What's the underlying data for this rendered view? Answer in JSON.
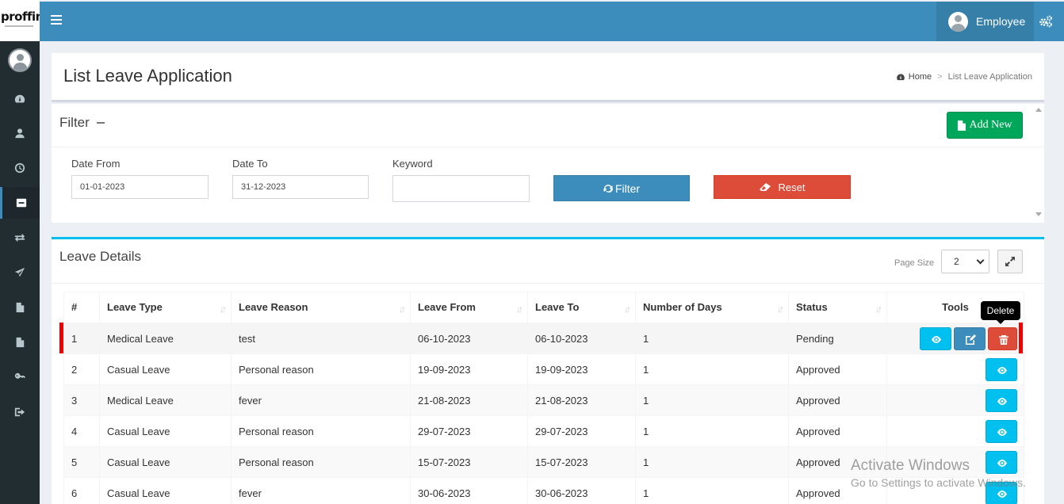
{
  "app": {
    "logo": "proffin"
  },
  "header": {
    "user_name": "Employee"
  },
  "page": {
    "title": "List Leave Application"
  },
  "breadcrumb": {
    "home": "Home",
    "current": "List Leave Application"
  },
  "filter": {
    "title": "Filter",
    "add_new_label": "Add New",
    "date_from_label": "Date From",
    "date_from_value": "01-01-2023",
    "date_to_label": "Date To",
    "date_to_value": "31-12-2023",
    "keyword_label": "Keyword",
    "keyword_value": "",
    "filter_button": "Filter",
    "reset_button": "Reset"
  },
  "details": {
    "title": "Leave Details",
    "page_size_label": "Page Size",
    "page_size_value": "2",
    "columns": [
      "#",
      "Leave Type",
      "Leave Reason",
      "Leave From",
      "Leave To",
      "Number of Days",
      "Status",
      "Tools"
    ],
    "rows": [
      {
        "no": "1",
        "type": "Medical Leave",
        "reason": "test",
        "from": "06-10-2023",
        "to": "06-10-2023",
        "days": "1",
        "status": "Pending"
      },
      {
        "no": "2",
        "type": "Casual Leave",
        "reason": "Personal reason",
        "from": "19-09-2023",
        "to": "19-09-2023",
        "days": "1",
        "status": "Approved"
      },
      {
        "no": "3",
        "type": "Medical Leave",
        "reason": "fever",
        "from": "21-08-2023",
        "to": "21-08-2023",
        "days": "1",
        "status": "Approved"
      },
      {
        "no": "4",
        "type": "Casual Leave",
        "reason": "Personal reason",
        "from": "29-07-2023",
        "to": "29-07-2023",
        "days": "1",
        "status": "Approved"
      },
      {
        "no": "5",
        "type": "Casual Leave",
        "reason": "Personal reason",
        "from": "15-07-2023",
        "to": "15-07-2023",
        "days": "1",
        "status": "Approved"
      },
      {
        "no": "6",
        "type": "Casual Leave",
        "reason": "fever",
        "from": "30-06-2023",
        "to": "30-06-2023",
        "days": "1",
        "status": "Approved"
      }
    ]
  },
  "tooltip": "Delete",
  "watermark": {
    "title": "Activate Windows",
    "subtitle": "Go to Settings to activate Windows."
  },
  "colors": {
    "header": "#3c8dbc",
    "sidebar": "#222d32",
    "success": "#00a65a",
    "danger": "#dd4b39",
    "info": "#00c0ef"
  }
}
